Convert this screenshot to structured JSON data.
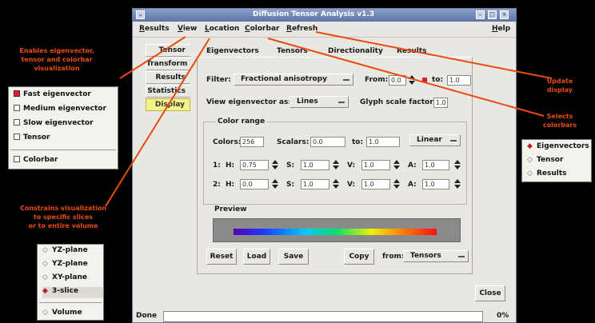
{
  "window": {
    "title": "Diffusion Tensor Analysis v1.3"
  },
  "menu": [
    "Results",
    "View",
    "Location",
    "Colorbar",
    "Refresh",
    "Help"
  ],
  "nav_tabs": [
    "Tensor",
    "Transform",
    "Results",
    "Statistics",
    "Display"
  ],
  "active_nav": "Display",
  "top_tabs": [
    "Eigenvectors",
    "Tensors",
    "Directionality",
    "Results"
  ],
  "filter": {
    "label": "Filter:",
    "value": "Fractional anisotropy",
    "from_label": "From:",
    "from_value": "0.0",
    "to_label": "to:",
    "to_value": "1.0"
  },
  "view_as": {
    "label": "View eigenvector as:",
    "value": "Lines",
    "glyph_label": "Glyph scale factor:",
    "glyph_value": "1.0"
  },
  "color_range": {
    "title": "Color range",
    "colors_label": "Colors:",
    "colors_value": "256",
    "scalars_label": "Scalars:",
    "scalars_value": "0.0",
    "to_label": "to:",
    "to_value": "1.0",
    "mode": "Linear",
    "row1": {
      "idx": "1:",
      "h": "0.75",
      "s": "1.0",
      "v": "1.0",
      "a": "1.0"
    },
    "row2": {
      "idx": "2:",
      "h": "0.0",
      "s": "1.0",
      "v": "1.0",
      "a": "1.0"
    },
    "h_label": "H:",
    "s_label": "S:",
    "v_label": "V:",
    "a_label": "A:"
  },
  "preview": {
    "title": "Preview"
  },
  "buttons": {
    "reset": "Reset",
    "load": "Load",
    "save": "Save",
    "copy": "Copy",
    "from_label": "from:",
    "from_value": "Tensors",
    "close": "Close"
  },
  "status": {
    "text": "Done",
    "percent": "0%"
  },
  "notes": {
    "eigen": [
      "Enables eigenvector,",
      "tensor and colorbar",
      "visualization"
    ],
    "constrain": [
      "Constrains visualization",
      "to specific slices",
      "or to entire volume"
    ],
    "update": [
      "Update",
      "display"
    ],
    "selects": [
      "Selects",
      "colorbars"
    ]
  },
  "view_menu": {
    "items": [
      {
        "label": "Fast eigenvector",
        "checked": true
      },
      {
        "label": "Medium eigenvector",
        "checked": false
      },
      {
        "label": "Slow eigenvector",
        "checked": false
      },
      {
        "label": "Tensor",
        "checked": false
      },
      {
        "label": "Colorbar",
        "checked": false
      }
    ]
  },
  "location_menu": {
    "items": [
      {
        "label": "YZ-plane",
        "selected": false
      },
      {
        "label": "YZ-plane",
        "selected": false
      },
      {
        "label": "XY-plane",
        "selected": false
      },
      {
        "label": "3-slice",
        "selected": true
      },
      {
        "label": "Volume",
        "selected": false
      }
    ]
  },
  "colorbar_menu": {
    "items": [
      {
        "label": "Eigenvectors",
        "selected": true
      },
      {
        "label": "Tensor",
        "selected": false
      },
      {
        "label": "Results",
        "selected": false
      }
    ]
  },
  "colors": {
    "accent": "#e84b10",
    "titlebar": "#6c84b4",
    "active_tab": "#f3f38a"
  }
}
